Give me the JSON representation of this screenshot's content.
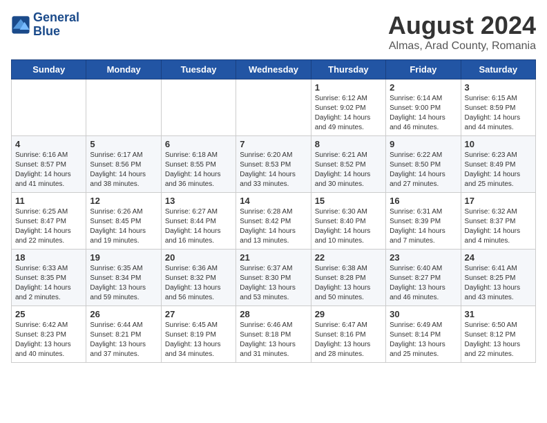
{
  "logo": {
    "line1": "General",
    "line2": "Blue"
  },
  "title": "August 2024",
  "location": "Almas, Arad County, Romania",
  "weekdays": [
    "Sunday",
    "Monday",
    "Tuesday",
    "Wednesday",
    "Thursday",
    "Friday",
    "Saturday"
  ],
  "weeks": [
    [
      {
        "day": "",
        "info": ""
      },
      {
        "day": "",
        "info": ""
      },
      {
        "day": "",
        "info": ""
      },
      {
        "day": "",
        "info": ""
      },
      {
        "day": "1",
        "info": "Sunrise: 6:12 AM\nSunset: 9:02 PM\nDaylight: 14 hours\nand 49 minutes."
      },
      {
        "day": "2",
        "info": "Sunrise: 6:14 AM\nSunset: 9:00 PM\nDaylight: 14 hours\nand 46 minutes."
      },
      {
        "day": "3",
        "info": "Sunrise: 6:15 AM\nSunset: 8:59 PM\nDaylight: 14 hours\nand 44 minutes."
      }
    ],
    [
      {
        "day": "4",
        "info": "Sunrise: 6:16 AM\nSunset: 8:57 PM\nDaylight: 14 hours\nand 41 minutes."
      },
      {
        "day": "5",
        "info": "Sunrise: 6:17 AM\nSunset: 8:56 PM\nDaylight: 14 hours\nand 38 minutes."
      },
      {
        "day": "6",
        "info": "Sunrise: 6:18 AM\nSunset: 8:55 PM\nDaylight: 14 hours\nand 36 minutes."
      },
      {
        "day": "7",
        "info": "Sunrise: 6:20 AM\nSunset: 8:53 PM\nDaylight: 14 hours\nand 33 minutes."
      },
      {
        "day": "8",
        "info": "Sunrise: 6:21 AM\nSunset: 8:52 PM\nDaylight: 14 hours\nand 30 minutes."
      },
      {
        "day": "9",
        "info": "Sunrise: 6:22 AM\nSunset: 8:50 PM\nDaylight: 14 hours\nand 27 minutes."
      },
      {
        "day": "10",
        "info": "Sunrise: 6:23 AM\nSunset: 8:49 PM\nDaylight: 14 hours\nand 25 minutes."
      }
    ],
    [
      {
        "day": "11",
        "info": "Sunrise: 6:25 AM\nSunset: 8:47 PM\nDaylight: 14 hours\nand 22 minutes."
      },
      {
        "day": "12",
        "info": "Sunrise: 6:26 AM\nSunset: 8:45 PM\nDaylight: 14 hours\nand 19 minutes."
      },
      {
        "day": "13",
        "info": "Sunrise: 6:27 AM\nSunset: 8:44 PM\nDaylight: 14 hours\nand 16 minutes."
      },
      {
        "day": "14",
        "info": "Sunrise: 6:28 AM\nSunset: 8:42 PM\nDaylight: 14 hours\nand 13 minutes."
      },
      {
        "day": "15",
        "info": "Sunrise: 6:30 AM\nSunset: 8:40 PM\nDaylight: 14 hours\nand 10 minutes."
      },
      {
        "day": "16",
        "info": "Sunrise: 6:31 AM\nSunset: 8:39 PM\nDaylight: 14 hours\nand 7 minutes."
      },
      {
        "day": "17",
        "info": "Sunrise: 6:32 AM\nSunset: 8:37 PM\nDaylight: 14 hours\nand 4 minutes."
      }
    ],
    [
      {
        "day": "18",
        "info": "Sunrise: 6:33 AM\nSunset: 8:35 PM\nDaylight: 14 hours\nand 2 minutes."
      },
      {
        "day": "19",
        "info": "Sunrise: 6:35 AM\nSunset: 8:34 PM\nDaylight: 13 hours\nand 59 minutes."
      },
      {
        "day": "20",
        "info": "Sunrise: 6:36 AM\nSunset: 8:32 PM\nDaylight: 13 hours\nand 56 minutes."
      },
      {
        "day": "21",
        "info": "Sunrise: 6:37 AM\nSunset: 8:30 PM\nDaylight: 13 hours\nand 53 minutes."
      },
      {
        "day": "22",
        "info": "Sunrise: 6:38 AM\nSunset: 8:28 PM\nDaylight: 13 hours\nand 50 minutes."
      },
      {
        "day": "23",
        "info": "Sunrise: 6:40 AM\nSunset: 8:27 PM\nDaylight: 13 hours\nand 46 minutes."
      },
      {
        "day": "24",
        "info": "Sunrise: 6:41 AM\nSunset: 8:25 PM\nDaylight: 13 hours\nand 43 minutes."
      }
    ],
    [
      {
        "day": "25",
        "info": "Sunrise: 6:42 AM\nSunset: 8:23 PM\nDaylight: 13 hours\nand 40 minutes."
      },
      {
        "day": "26",
        "info": "Sunrise: 6:44 AM\nSunset: 8:21 PM\nDaylight: 13 hours\nand 37 minutes."
      },
      {
        "day": "27",
        "info": "Sunrise: 6:45 AM\nSunset: 8:19 PM\nDaylight: 13 hours\nand 34 minutes."
      },
      {
        "day": "28",
        "info": "Sunrise: 6:46 AM\nSunset: 8:18 PM\nDaylight: 13 hours\nand 31 minutes."
      },
      {
        "day": "29",
        "info": "Sunrise: 6:47 AM\nSunset: 8:16 PM\nDaylight: 13 hours\nand 28 minutes."
      },
      {
        "day": "30",
        "info": "Sunrise: 6:49 AM\nSunset: 8:14 PM\nDaylight: 13 hours\nand 25 minutes."
      },
      {
        "day": "31",
        "info": "Sunrise: 6:50 AM\nSunset: 8:12 PM\nDaylight: 13 hours\nand 22 minutes."
      }
    ]
  ]
}
